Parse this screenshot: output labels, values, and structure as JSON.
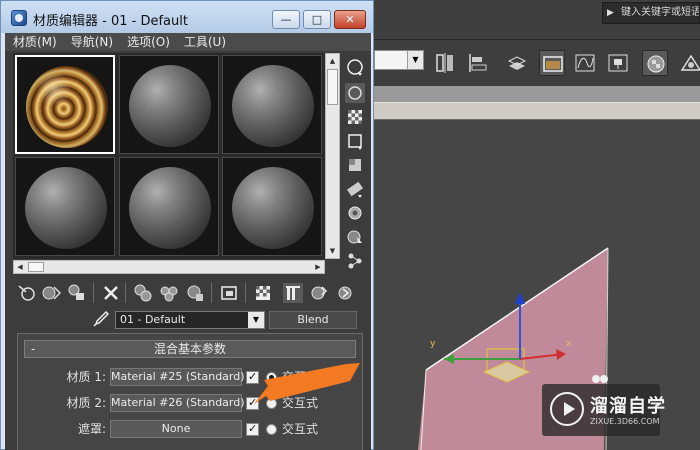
{
  "background": {
    "search_placeholder": "键入关键字或短语",
    "viewport_axes": {
      "x": "x",
      "y": "y"
    }
  },
  "dialog": {
    "title": "材质编辑器 - 01 - Default",
    "buttons": {
      "minimize": "—",
      "maximize": "□",
      "close": "✕"
    },
    "menu": [
      "材质(M)",
      "导航(N)",
      "选项(O)",
      "工具(U)"
    ]
  },
  "slots": [
    {
      "type": "ornate",
      "active": true
    },
    {
      "type": "default"
    },
    {
      "type": "default"
    },
    {
      "type": "default"
    },
    {
      "type": "default"
    },
    {
      "type": "default"
    }
  ],
  "material": {
    "name": "01 - Default",
    "type": "Blend"
  },
  "rollout": {
    "toggle": "-",
    "title": "混合基本参数",
    "rows": [
      {
        "label": "材质 1:",
        "value": "Material #25 (Standard)",
        "mode": "交互式",
        "radio_selected": true
      },
      {
        "label": "材质 2:",
        "value": "Material #26 (Standard)",
        "mode": "交互式",
        "radio_selected": false
      },
      {
        "label": "遮罩:",
        "value": "None",
        "mode": "交互式",
        "radio_selected": false
      }
    ]
  },
  "watermark": {
    "title": "溜溜自学",
    "url": "ZIXUE.3D66.COM"
  },
  "colors": {
    "arrow": "#f37a22",
    "plane": "#c88ea0",
    "title_bar": "#c4d7ee",
    "editor_bg": "#3c3c3c"
  },
  "icons": {
    "side": [
      "sample-sphere-icon",
      "backlight-icon",
      "checker-background-icon",
      "sample-uv-tiling-icon",
      "video-color-check-icon",
      "make-preview-icon",
      "options-icon",
      "select-by-material-icon",
      "material-navigator-icon"
    ],
    "bottom": [
      "get-material-icon",
      "put-to-scene-icon",
      "assign-to-selection-icon",
      "reset-map-icon",
      "make-unique-icon",
      "put-to-library-icon",
      "material-id-icon",
      "show-shaded-icon",
      "show-end-result-icon",
      "go-to-parent-icon",
      "go-forward-icon"
    ]
  }
}
